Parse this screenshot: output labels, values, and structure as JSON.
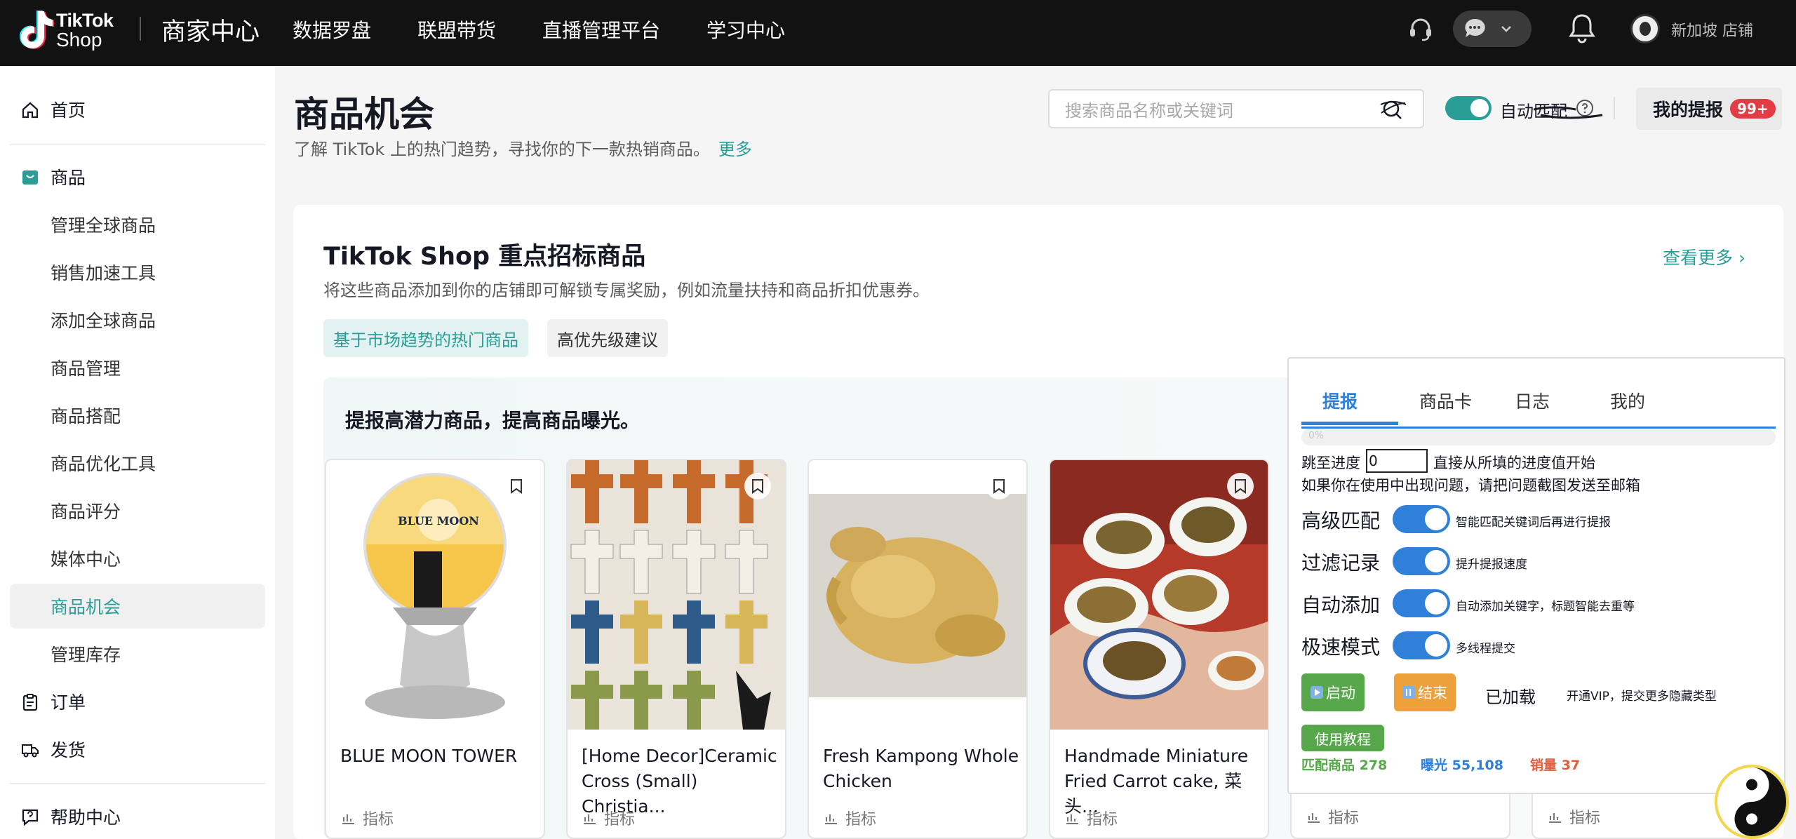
{
  "header": {
    "logo_line1": "TikTok",
    "logo_line2": "Shop",
    "brand": "商家中心",
    "nav": [
      "数据罗盘",
      "联盟带货",
      "直播管理平台",
      "学习中心"
    ],
    "store": "新加坡 店铺"
  },
  "sidebar": {
    "home": "首页",
    "products": "商品",
    "product_items": [
      "管理全球商品",
      "销售加速工具",
      "添加全球商品",
      "商品管理",
      "商品搭配",
      "商品优化工具",
      "商品评分",
      "媒体中心",
      "商品机会",
      "管理库存"
    ],
    "active_item": "商品机会",
    "orders": "订单",
    "shipping": "发货",
    "help": "帮助中心"
  },
  "main": {
    "title": "商品机会",
    "subtitle": "了解 TikTok 上的热门趋势，寻找你的下一款热销商品。",
    "more_link": "更多",
    "search_placeholder": "搜索商品名称或关键词",
    "auto_match_label": "自动匹配",
    "my_report": "我的提报",
    "my_report_badge": "99+"
  },
  "card": {
    "title": "TikTok Shop 重点招标商品",
    "subtitle": "将这些商品添加到你的店铺即可解锁专属奖励，例如流量扶持和商品折扣优惠券。",
    "see_more": "查看更多 ›",
    "chips": [
      "基于市场趋势的热门商品",
      "高优先级建议"
    ],
    "promo_title": "提报高潜力商品，提高商品曝光。",
    "products": [
      {
        "name": "BLUE MOON TOWER",
        "metric": "指标"
      },
      {
        "name": "[Home Decor]Ceramic Cross (Small) Christia...",
        "metric": "指标"
      },
      {
        "name": "Fresh Kampong Whole Chicken",
        "metric": "指标"
      },
      {
        "name": "Handmade Miniature Fried Carrot cake, 菜头...",
        "metric": "指标"
      }
    ],
    "hidden_metrics": [
      "指标",
      "指标"
    ]
  },
  "panel": {
    "tabs": [
      "提报",
      "商品卡",
      "日志",
      "我的"
    ],
    "progress_text": "0%",
    "progress": 0,
    "jump_label": "跳至进度",
    "jump_value": "0",
    "jump_tip": "直接从所填的进度值开始",
    "mail_tip": "如果你在使用中出现问题，请把问题截图发送至邮箱",
    "options": [
      {
        "label": "高级匹配",
        "desc": "智能匹配关键词后再进行提报"
      },
      {
        "label": "过滤记录",
        "desc": "提升提报速度"
      },
      {
        "label": "自动添加",
        "desc": "自动添加关键字，标题智能去重等"
      },
      {
        "label": "极速模式",
        "desc": "多线程提交"
      }
    ],
    "start_label": "启动",
    "end_label": "结束",
    "loaded_label": "已加载",
    "vip_tip": "开通VIP，提交更多隐藏类型",
    "tutorial_label": "使用教程",
    "stats": {
      "match": "匹配商品 278",
      "exposure": "曝光 55,108",
      "sales": "销量 37"
    }
  },
  "colors": {
    "accent": "#2a9d97",
    "panel_blue": "#2f80d8",
    "badge_red": "#e23c44",
    "green": "#57a84a",
    "orange": "#eca13a"
  }
}
